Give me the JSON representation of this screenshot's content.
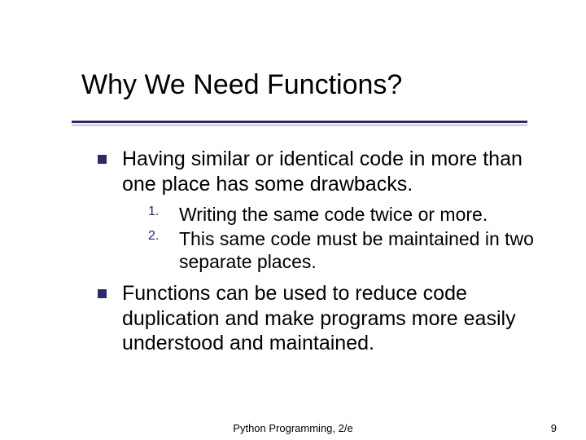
{
  "title": "Why We Need Functions?",
  "bullets": [
    {
      "text": "Having similar or identical code in more than one place has some drawbacks.",
      "sub": [
        {
          "num": "1.",
          "text": "Writing the same code twice or more."
        },
        {
          "num": "2.",
          "text": "This same code must be maintained in two separate places."
        }
      ]
    },
    {
      "text": "Functions can be used to reduce code duplication and make programs more easily understood and maintained.",
      "sub": []
    }
  ],
  "footer": {
    "center": "Python Programming, 2/e",
    "page": "9"
  },
  "colors": {
    "accent": "#2a2a6a"
  }
}
